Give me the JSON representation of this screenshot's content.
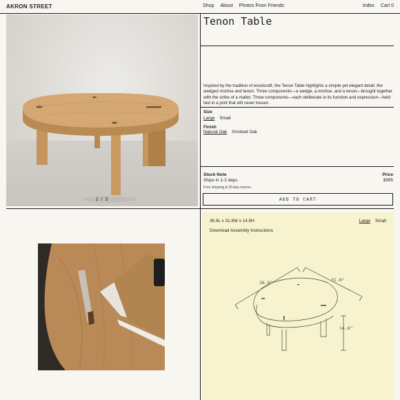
{
  "header": {
    "brand": "AKRON STREET",
    "nav": [
      "Shop",
      "About",
      "Photos From Friends"
    ],
    "nav_right": [
      "Index",
      "Cart 0"
    ]
  },
  "gallery": {
    "counter": "1 / 3"
  },
  "product": {
    "title": "Tenon Table",
    "description": "Inspired by the tradition of woodcraft, the Tenon Table highlights a simple yet elegant detail: the wedged mortise and tenon. Three components—a wedge, a mortise, and a tenon—brought together with the strike of a mallet. Three components—each deliberate in its function and expression—held fast in a joint that will never loosen.",
    "size_label": "Size",
    "sizes": [
      "Large",
      "Small"
    ],
    "finish_label": "Finish",
    "finishes": [
      "Natural Oak",
      "Smoked Oak"
    ],
    "stock_label": "Stock Note",
    "stock_value": "Ships in 1-2 days.",
    "price_label": "Price",
    "price_value": "$995",
    "shipping_note": "Free shipping & 30-day returns.",
    "add_to_cart": "ADD TO CART"
  },
  "spec": {
    "dimensions": "36.9L x 31.8W x 14.6H",
    "download": "Download Assembly Instructions",
    "sizes": [
      "Large",
      "Small"
    ],
    "dim_length": "36.9\"",
    "dim_width": "31.8\"",
    "dim_height": "14.6\""
  },
  "colors": {
    "background": "#f8f6f1",
    "spec_panel": "#f6f3ce",
    "wood": "#c79a63"
  }
}
